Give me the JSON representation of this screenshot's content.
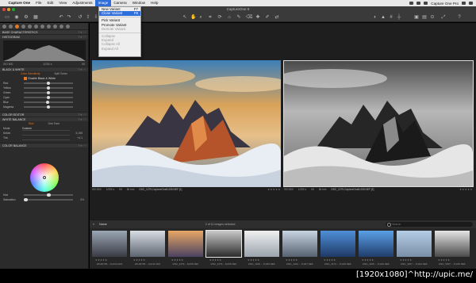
{
  "menubar": {
    "apple": "",
    "items": [
      "Capture One",
      "File",
      "Edit",
      "View",
      "Adjustments",
      "Image",
      "Camera",
      "Window",
      "Help"
    ],
    "active_index": 5,
    "right_text": "Capture One Pro"
  },
  "window": {
    "title": "CaptureOne 8"
  },
  "dropdown": {
    "items": [
      {
        "label": "New Variant",
        "shortcut": "F7",
        "state": "normal"
      },
      {
        "label": "Clone Variant",
        "shortcut": "F8",
        "state": "highlighted"
      },
      {
        "sep": true
      },
      {
        "label": "Pick Variant",
        "shortcut": "",
        "state": "normal"
      },
      {
        "label": "Promote Variant",
        "shortcut": "",
        "state": "normal"
      },
      {
        "label": "Demote Variant",
        "shortcut": "",
        "state": "disabled"
      },
      {
        "sep": true
      },
      {
        "label": "Collapse",
        "shortcut": "",
        "state": "disabled"
      },
      {
        "label": "Expand",
        "shortcut": "",
        "state": "disabled"
      },
      {
        "label": "Collapse All",
        "shortcut": "",
        "state": "disabled"
      },
      {
        "label": "Expand All",
        "shortcut": "",
        "state": "disabled"
      }
    ]
  },
  "left_panel": {
    "base_characteristics": "BASE CHARACTERISTICS",
    "histogram": "HISTOGRAM",
    "histo_meta": {
      "iso": "ISO 800",
      "shutter": "1/250 s"
    },
    "black_white": "BLACK & WHITE",
    "bw_tabs": [
      "Color Sensitivity",
      "Split Tones"
    ],
    "enable_bw": "Enable Black & White",
    "bw_sliders": [
      {
        "label": "Red",
        "pos": 0.5
      },
      {
        "label": "Yellow",
        "pos": 0.5
      },
      {
        "label": "Green",
        "pos": 0.5
      },
      {
        "label": "Cyan",
        "pos": 0.5
      },
      {
        "label": "Blue",
        "pos": 0.48
      },
      {
        "label": "Magenta",
        "pos": 0.5
      }
    ],
    "color_editor": "COLOR EDITOR",
    "white_balance": "WHITE BALANCE",
    "wb_tabs": [
      "Skin",
      "One Tone"
    ],
    "wb_mode_label": "Mode",
    "wb_mode_value": "Custom",
    "wb_kelvin_label": "Kelvin",
    "wb_kelvin_value": "5,195",
    "wb_tint_label": "Tint",
    "wb_tint_value": "+4.1",
    "color_balance": "COLOR BALANCE",
    "hue_label": "Hue",
    "saturation_label": "Saturation",
    "saturation_value": "0%"
  },
  "viewer": {
    "left": {
      "meta": [
        "ISO 800",
        "1/250 s",
        "f/8",
        "86 mm"
      ],
      "name": "DSC_1279-CaptureOne8-005.NEF [1]",
      "stars": "★★★★★"
    },
    "right": {
      "meta": [
        "ISO 800",
        "1/250 s",
        "f/8",
        "86 mm"
      ],
      "name": "DSC_1279-CaptureOne8-005.NEF [2]",
      "stars": "★★★★★"
    }
  },
  "browser": {
    "sort_label": "Name",
    "count": "2 of 11 images selected",
    "search_placeholder": "Search"
  },
  "thumbnails": [
    {
      "name": "20140705-...AI-010.CR2",
      "colors": [
        "#9aa7b4",
        "#3a3a44"
      ],
      "sel": false
    },
    {
      "name": "20140705-...AI-011.CR2",
      "colors": [
        "#d9dde4",
        "#5d6570"
      ],
      "sel": false
    },
    {
      "name": "DSC_1279-...8-005.NEF",
      "colors": [
        "#e8a766",
        "#4b4260"
      ],
      "sel": false
    },
    {
      "name": "DSC_1279-...8-005.NEF",
      "colors": [
        "#c9c9c9",
        "#2b2b2b"
      ],
      "sel": true
    },
    {
      "name": "DSC_1326 -...8-006.NEF",
      "colors": [
        "#f0f0f0",
        "#9aa3ad"
      ],
      "sel": false
    },
    {
      "name": "DSC_1344 -...8-007.NEF",
      "colors": [
        "#c7d4e2",
        "#576270"
      ],
      "sel": false
    },
    {
      "name": "DSC_3172 -...8-018.NEF",
      "colors": [
        "#4f8fd8",
        "#1f3a66"
      ],
      "sel": false
    },
    {
      "name": "DSC_3226 -...8-019.NEF",
      "colors": [
        "#5aa0e8",
        "#203c6a"
      ],
      "sel": false
    },
    {
      "name": "DSC_3927 -...8-024.NEF",
      "colors": [
        "#b5cde6",
        "#7a8fa8"
      ],
      "sel": false
    },
    {
      "name": "DSC_5397 -...8-025.NEF",
      "colors": [
        "#e5e5e5",
        "#4a4a4a"
      ],
      "sel": false
    }
  ],
  "watermark": "[1920x1080]^http://upic.me/",
  "colors": {
    "accent": "#e87722",
    "menu_highlight": "#2f6fdc"
  }
}
